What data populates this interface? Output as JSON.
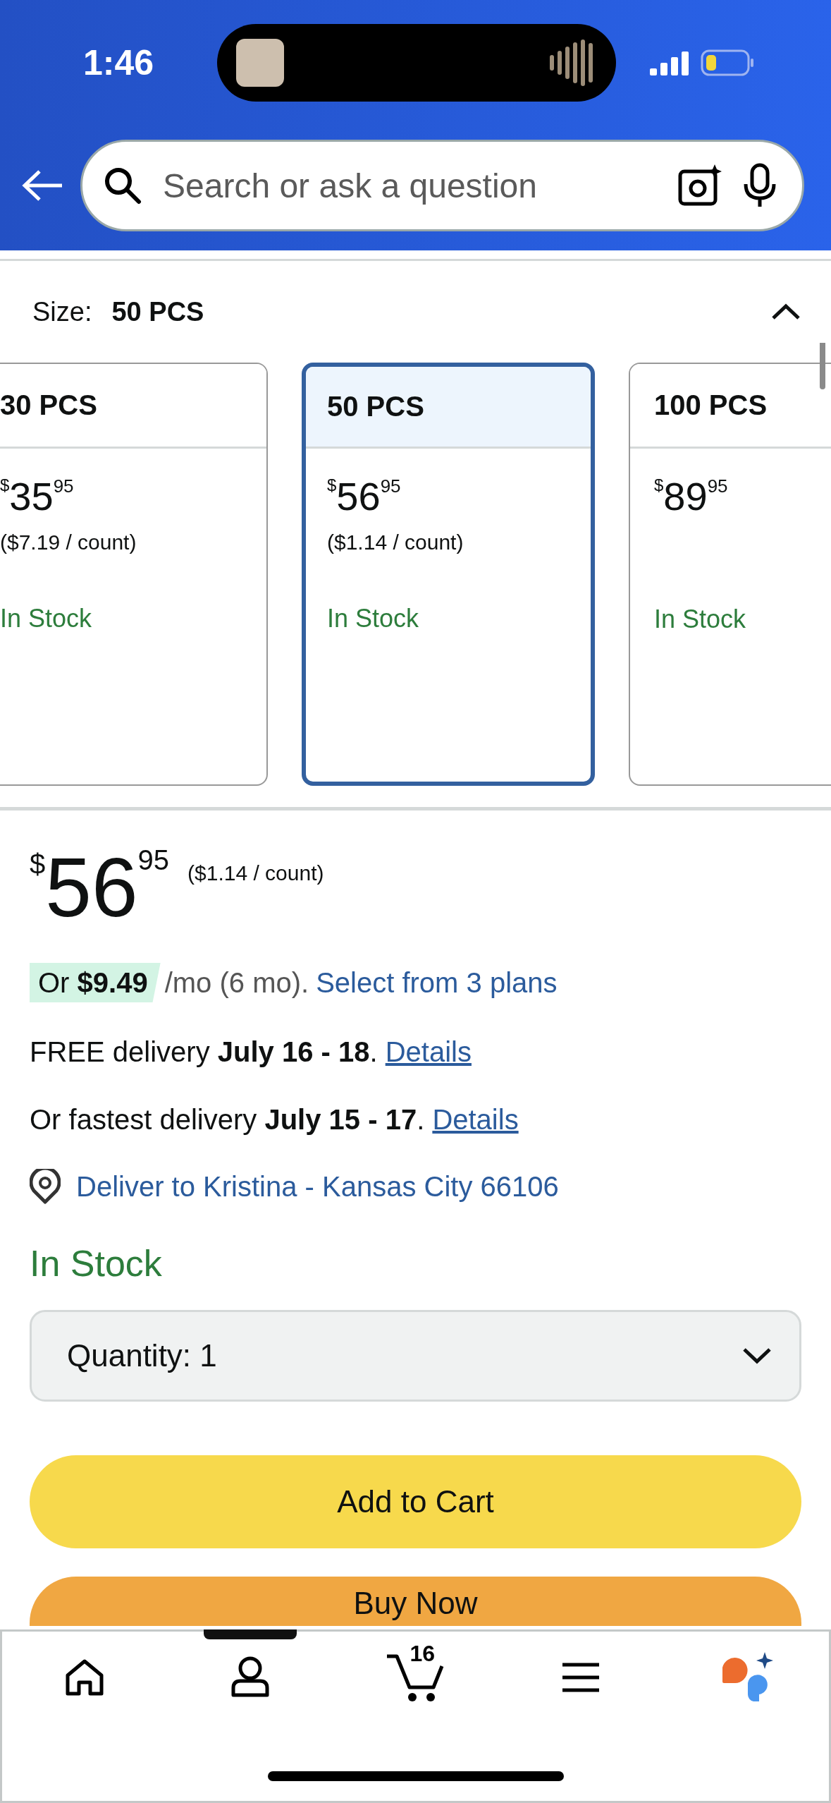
{
  "status_bar": {
    "time": "1:46"
  },
  "search": {
    "placeholder": "Search or ask a question"
  },
  "size_selector": {
    "label": "Size:",
    "value": "50 PCS",
    "expanded": true
  },
  "size_options": [
    {
      "name": "30 PCS",
      "currency": "$",
      "whole": "35",
      "fraction": "95",
      "unit_price": "($7.19 / count)",
      "availability": "In Stock",
      "selected": false
    },
    {
      "name": "50 PCS",
      "currency": "$",
      "whole": "56",
      "fraction": "95",
      "unit_price": "($1.14 / count)",
      "availability": "In Stock",
      "selected": true
    },
    {
      "name": "100 PCS",
      "currency": "$",
      "whole": "89",
      "fraction": "95",
      "availability": "In Stock",
      "selected": false
    }
  ],
  "price": {
    "currency": "$",
    "whole": "56",
    "fraction": "95",
    "unit_price": "($1.14 / count)"
  },
  "installment": {
    "badge": "Or **$9.49**",
    "terms": "/mo (6 mo).",
    "link": "Select from 3 plans"
  },
  "delivery": [
    {
      "text": "FREE delivery **July 16 - 18**.",
      "link": "Details"
    },
    {
      "text": "Or fastest delivery **July 15 - 17**.",
      "link": "Details"
    }
  ],
  "deliver_to": "Deliver to Kristina - Kansas City 66106",
  "availability": "In Stock",
  "quantity": {
    "label": "Quantity:",
    "value": "1"
  },
  "buttons": [
    {
      "label": "Add to Cart",
      "kind": "add"
    },
    {
      "label": "Buy Now",
      "kind": "buy"
    }
  ],
  "bottom_nav": [
    {
      "kind": "home",
      "selected": false
    },
    {
      "kind": "account",
      "selected": true
    },
    {
      "kind": "cart",
      "badge": "16",
      "selected": false
    },
    {
      "kind": "menu",
      "selected": false
    },
    {
      "kind": "assistant",
      "selected": false
    }
  ]
}
